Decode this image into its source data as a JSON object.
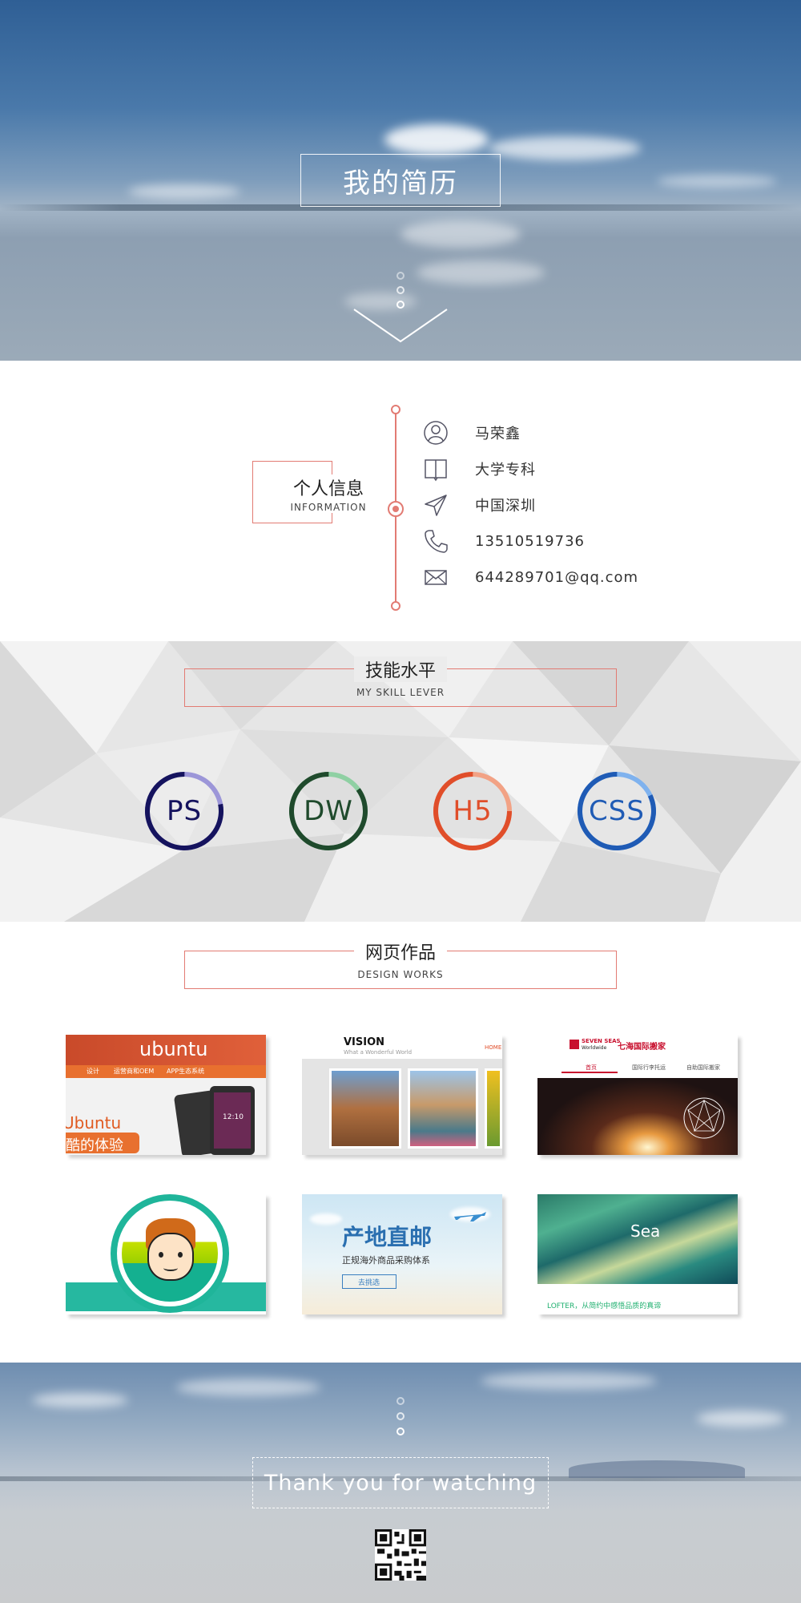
{
  "hero": {
    "title": "我的简历"
  },
  "info": {
    "title_zh": "个人信息",
    "title_en": "INFORMATION",
    "items": [
      {
        "icon": "user-icon",
        "text": "马荣鑫"
      },
      {
        "icon": "book-icon",
        "text": "大学专科"
      },
      {
        "icon": "location-arrow-icon",
        "text": "中国深圳"
      },
      {
        "icon": "phone-icon",
        "text": "13510519736"
      },
      {
        "icon": "mail-icon",
        "text": "644289701@qq.com"
      }
    ]
  },
  "skills": {
    "title_zh": "技能水平",
    "title_en": "MY SKILL LEVER",
    "items": [
      {
        "label": "PS",
        "color": "#15135e",
        "accent": "#9c96d8",
        "level": 0.78
      },
      {
        "label": "DW",
        "color": "#1f4a2c",
        "accent": "#8fd0a3",
        "level": 0.85
      },
      {
        "label": "H5",
        "color": "#e04e2a",
        "accent": "#f2a285",
        "level": 0.75
      },
      {
        "label": "CSS",
        "color": "#1f5bb5",
        "accent": "#7fb2ee",
        "level": 0.82
      }
    ]
  },
  "works": {
    "title_zh": "网页作品",
    "title_en": "DESIGN WORKS",
    "items": [
      {
        "name": "ubuntu",
        "texts": {
          "brand": "ubuntu",
          "nav1": "设计",
          "nav2": "运营商和OEM",
          "nav3": "APP生态系统",
          "hero1": "Ubuntu",
          "hero2": "酷的体验",
          "time": "12:10"
        }
      },
      {
        "name": "vision",
        "texts": {
          "brand": "VISION",
          "sub": "What a Wonderful World",
          "link": "HOME"
        }
      },
      {
        "name": "seven-seas",
        "texts": {
          "brand": "SEVEN SEAS",
          "brand2": "Worldwide",
          "cn": "七海国际搬家",
          "nav1": "首页",
          "nav2": "国际行李托运",
          "nav3": "自助国际搬家"
        }
      },
      {
        "name": "cartoon-avatar",
        "texts": {}
      },
      {
        "name": "chandi-zhiyou",
        "texts": {
          "title": "产地直邮",
          "sub": "正规海外商品采购体系",
          "btn": "去挑选"
        }
      },
      {
        "name": "sea",
        "texts": {
          "title": "Sea",
          "caption": "LOFTER，从简约中感悟品质的真谛"
        }
      }
    ]
  },
  "footer": {
    "thanks": "Thank you for watching"
  },
  "colors": {
    "accent": "#e27b73"
  }
}
